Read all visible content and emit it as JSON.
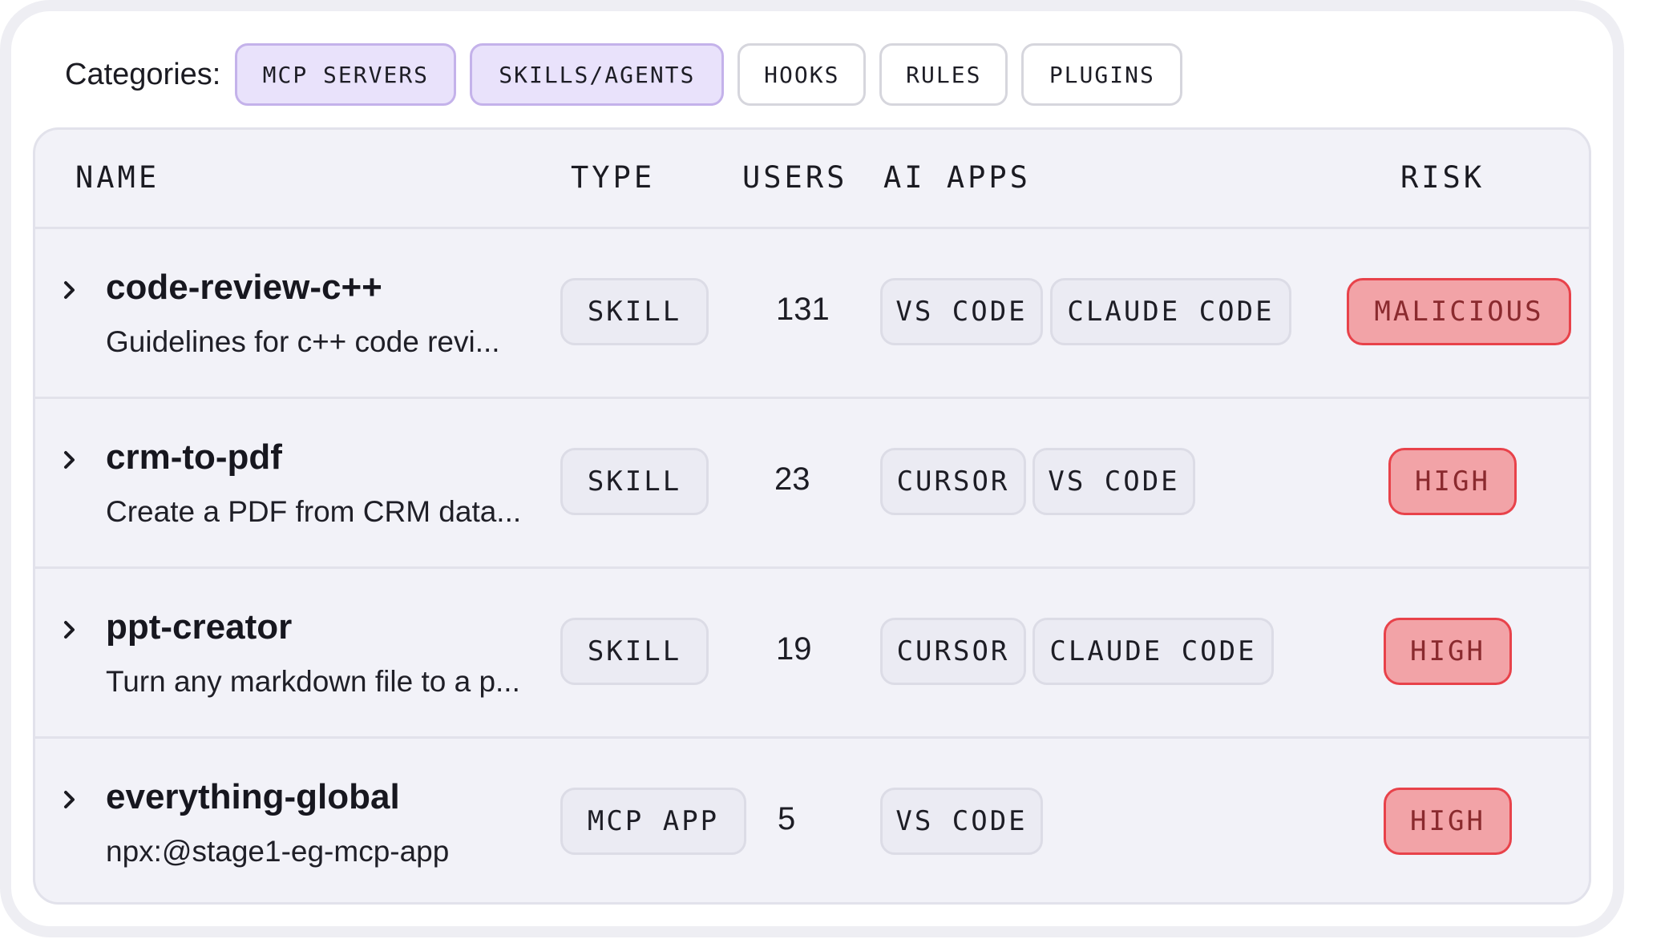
{
  "filters": {
    "label": "Categories:",
    "chips": [
      {
        "label": "MCP SERVERS",
        "active": true
      },
      {
        "label": "SKILLS/AGENTS",
        "active": true
      },
      {
        "label": "HOOKS",
        "active": false
      },
      {
        "label": "RULES",
        "active": false
      },
      {
        "label": "PLUGINS",
        "active": false
      }
    ]
  },
  "table": {
    "headers": {
      "name": "NAME",
      "type": "TYPE",
      "users": "USERS",
      "ai_apps": "AI APPS",
      "risk": "RISK"
    },
    "rows": [
      {
        "name": "code-review-c++",
        "description": "Guidelines for c++ code revi...",
        "type": "SKILL",
        "users": "131",
        "apps": [
          "VS CODE",
          "CLAUDE CODE"
        ],
        "risk": "MALICIOUS"
      },
      {
        "name": "crm-to-pdf",
        "description": "Create a PDF from CRM data...",
        "type": "SKILL",
        "users": "23",
        "apps": [
          "CURSOR",
          "VS CODE"
        ],
        "risk": "HIGH"
      },
      {
        "name": "ppt-creator",
        "description": "Turn any markdown file to a p...",
        "type": "SKILL",
        "users": "19",
        "apps": [
          "CURSOR",
          "CLAUDE CODE"
        ],
        "risk": "HIGH"
      },
      {
        "name": "everything-global",
        "description": "npx:@stage1-eg-mcp-app",
        "type": "MCP APP",
        "users": "5",
        "apps": [
          "VS CODE"
        ],
        "risk": "HIGH"
      }
    ]
  },
  "colors": {
    "active_chip_bg": "#e9e2fb",
    "risk_bg": "#f2a3a7",
    "risk_border": "#e8424a",
    "risk_text": "#8a2a2e"
  }
}
